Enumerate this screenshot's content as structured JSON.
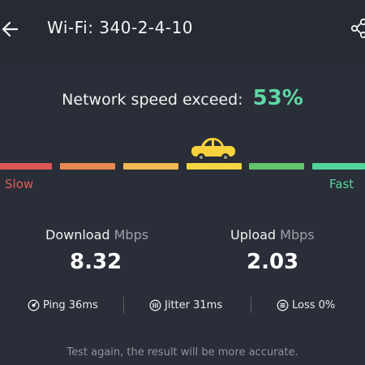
{
  "header": {
    "title": "Wi-Fi: 340-2-4-10",
    "back_icon": "back-arrow-icon",
    "share_icon": "share-icon"
  },
  "speed": {
    "headline": "Network speed exceed:",
    "percent": "53%",
    "slow_label": "Slow",
    "fast_label": "Fast",
    "colors": [
      "#de5656",
      "#ea8a52",
      "#f0b955",
      "#f3d642",
      "#62c46c",
      "#52d59b"
    ]
  },
  "download": {
    "label": "Download",
    "unit": "Mbps",
    "value": "8.32"
  },
  "upload": {
    "label": "Upload",
    "unit": "Mbps",
    "value": "2.03"
  },
  "metrics": {
    "ping": "Ping 36ms",
    "jitter": "Jitter 31ms",
    "loss": "Loss 0%"
  },
  "footer": "Test again, the result will be more accurate.",
  "accent_color": "#5fd8a5"
}
